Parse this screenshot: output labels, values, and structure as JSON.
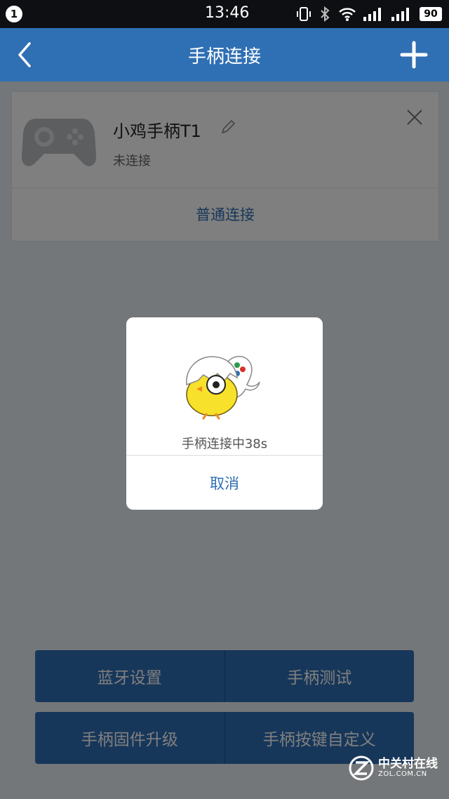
{
  "status_bar": {
    "notification_count": "1",
    "time": "13:46",
    "battery": "90",
    "icons": [
      "vibrate-icon",
      "bluetooth-icon",
      "wifi-icon",
      "signal-icon",
      "signal-icon"
    ]
  },
  "nav": {
    "title": "手柄连接",
    "back_icon": "back-chevron-icon",
    "add_icon": "plus-icon"
  },
  "device_card": {
    "name": "小鸡手柄T1",
    "status": "未连接",
    "connect_label": "普通连接"
  },
  "dialog": {
    "message": "手柄连接中38s",
    "cancel_label": "取消"
  },
  "actions": {
    "bluetooth_settings": "蓝牙设置",
    "gamepad_test": "手柄测试",
    "firmware_upgrade": "手柄固件升级",
    "key_customize": "手柄按键自定义"
  },
  "watermark": {
    "cn": "中关村在线",
    "en": "ZOL.COM.CN"
  },
  "colors": {
    "primary": "#2f6fb4",
    "status_bar": "#0d0f12"
  }
}
